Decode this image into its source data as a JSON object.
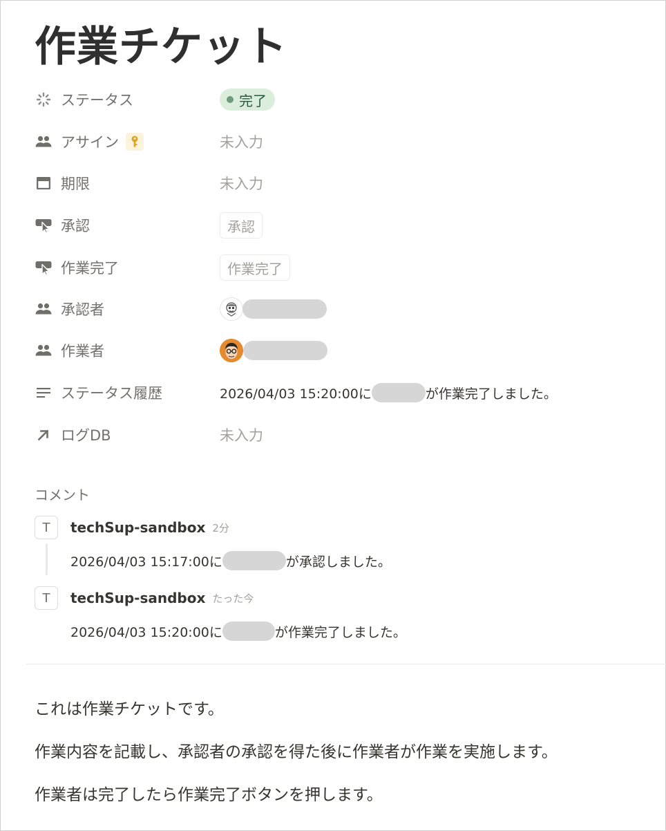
{
  "page": {
    "title": "作業チケット"
  },
  "properties": {
    "status": {
      "label": "ステータス",
      "value": "完了",
      "color": "#6c9b7d"
    },
    "assignee": {
      "label": "アサイン",
      "value": "未入力"
    },
    "due": {
      "label": "期限",
      "value": "未入力"
    },
    "approve": {
      "label": "承認",
      "button": "承認"
    },
    "complete": {
      "label": "作業完了",
      "button": "作業完了"
    },
    "approver": {
      "label": "承認者"
    },
    "worker": {
      "label": "作業者"
    },
    "history": {
      "label": "ステータス履歴",
      "prefix": "2026/04/03 15:20:00に",
      "suffix": "が作業完了しました。"
    },
    "log": {
      "label": "ログDB",
      "value": "未入力"
    }
  },
  "comments": {
    "label": "コメント",
    "items": [
      {
        "avatar": "T",
        "author": "techSup-sandbox",
        "time": "2分",
        "prefix": "2026/04/03 15:17:00に",
        "suffix": "が承認しました。"
      },
      {
        "avatar": "T",
        "author": "techSup-sandbox",
        "time": "たった今",
        "prefix": "2026/04/03 15:20:00に",
        "suffix": "が作業完了しました。"
      }
    ]
  },
  "body": [
    "これは作業チケットです。",
    "作業内容を記載し、承認者の承認を得た後に作業者が作業を実施します。",
    "作業者は完了したら作業完了ボタンを押します。"
  ]
}
